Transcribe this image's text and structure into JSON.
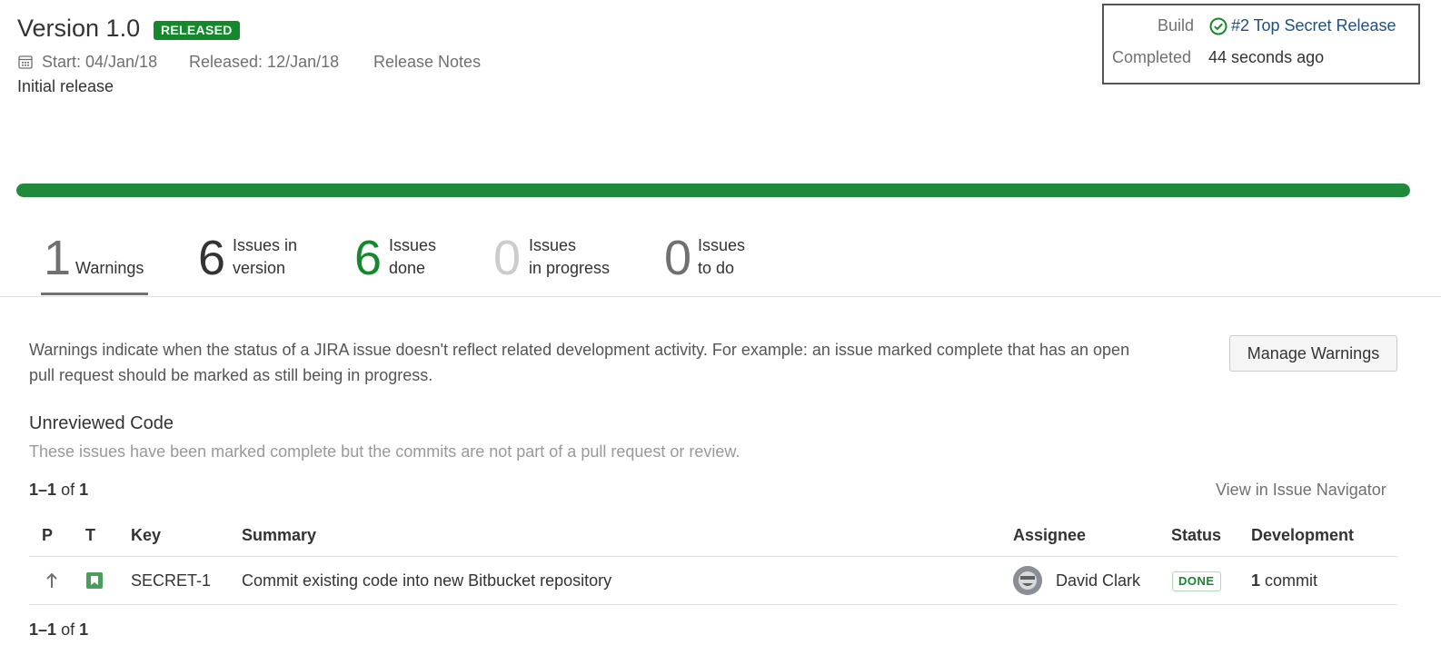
{
  "version": {
    "title": "Version 1.0",
    "status_badge": "RELEASED",
    "start": "Start: 04/Jan/18",
    "released": "Released: 12/Jan/18",
    "release_notes": "Release Notes",
    "description": "Initial release"
  },
  "build": {
    "label": "Build",
    "number": "#2",
    "name": "Top Secret Release",
    "completed_label": "Completed",
    "completed_value": "44 seconds ago"
  },
  "progress": {
    "percent": 100,
    "color": "#1f8a3b"
  },
  "stats": [
    {
      "count": "1",
      "label1": "",
      "label2": "Warnings",
      "color": "#707070"
    },
    {
      "count": "6",
      "label1": "Issues in",
      "label2": "version",
      "color": "#333333"
    },
    {
      "count": "6",
      "label1": "Issues",
      "label2": "done",
      "color": "#14892c"
    },
    {
      "count": "0",
      "label1": "Issues",
      "label2": "in progress",
      "color": "#cccccc"
    },
    {
      "count": "0",
      "label1": "Issues",
      "label2": "to do",
      "color": "#707070"
    }
  ],
  "warnings": {
    "intro_line1": "Warnings indicate when the status of a JIRA issue doesn't reflect related development activity. For example: an issue marked complete that has an open",
    "intro_line2": "pull request should be marked as still being in progress.",
    "manage_button": "Manage Warnings",
    "section_title": "Unreviewed Code",
    "section_subtitle": "These issues have been marked complete but the commits are not part of a pull request or review.",
    "range": "1–1",
    "of_text": "of",
    "total": "1",
    "navigator_link": "View in Issue Navigator"
  },
  "table": {
    "headers": {
      "p": "P",
      "t": "T",
      "key": "Key",
      "summary": "Summary",
      "assignee": "Assignee",
      "status": "Status",
      "development": "Development"
    },
    "rows": [
      {
        "priority_icon": "arrow-up-icon",
        "type_icon": "story-icon",
        "key": "SECRET-1",
        "summary": "Commit existing code into new Bitbucket repository",
        "assignee": "David Clark",
        "status": "DONE",
        "dev_count": "1",
        "dev_label": "commit"
      }
    ]
  }
}
